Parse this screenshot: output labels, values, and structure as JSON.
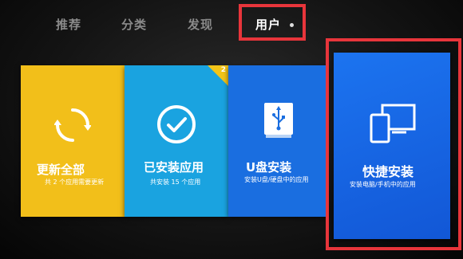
{
  "tabs": [
    {
      "label": "推荐",
      "active": false
    },
    {
      "label": "分类",
      "active": false
    },
    {
      "label": "发现",
      "active": false
    },
    {
      "label": "用户",
      "active": true
    }
  ],
  "tiles": {
    "update_all": {
      "title": "更新全部",
      "subtitle": "共 2 个应用需要更新",
      "icon": "refresh-icon",
      "color": "#f2bf1a"
    },
    "installed": {
      "title": "已安装应用",
      "subtitle": "共安装 15 个应用",
      "icon": "check-circle-icon",
      "color": "#1aa3e0",
      "badge": "2"
    },
    "usb_install": {
      "title": "U盘安装",
      "subtitle": "安装U盘/硬盘中的应用",
      "icon": "usb-drive-icon",
      "color": "#1a6ee0"
    },
    "quick_install": {
      "title": "快捷安装",
      "subtitle": "安装电脑/手机中的应用",
      "icon": "devices-icon",
      "color": "#1565e8"
    }
  },
  "colors": {
    "highlight": "#e8353b"
  }
}
